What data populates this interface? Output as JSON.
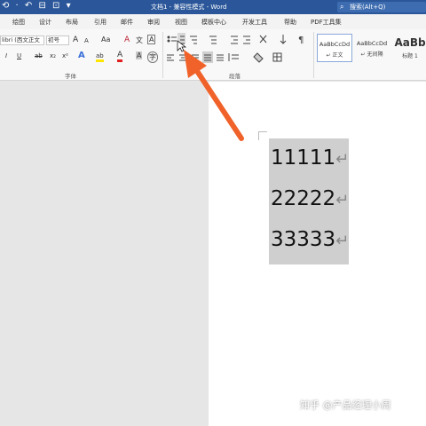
{
  "titlebar": {
    "quick_access": "⟲ · ↶ ⊟ ⊡ ▾",
    "title": "文档1 - 兼容性模式 - Word",
    "search_placeholder": "搜索(Alt+Q)"
  },
  "tabs": [
    "绘图",
    "设计",
    "布局",
    "引用",
    "邮件",
    "审阅",
    "视图",
    "模板中心",
    "开发工具",
    "帮助",
    "PDF工具集"
  ],
  "font": {
    "name": "libri (西文正文",
    "size": "初号",
    "grow": "A",
    "shrink": "A",
    "case": "Aa",
    "clear": "A",
    "phonetic": "文",
    "border_char": "A",
    "italic": "I",
    "underline": "U",
    "strike": "ab",
    "subscript": "x₂",
    "superscript": "x²",
    "effects": "A",
    "highlight": "ab",
    "font_color": "A",
    "shading": "A",
    "enclose": "字",
    "group_label": "字体"
  },
  "paragraph": {
    "group_label": "段落"
  },
  "styles": [
    {
      "sample": "AaBbCcDd",
      "name": "↵ 正文"
    },
    {
      "sample": "AaBbCcDd",
      "name": "↵ 无间隔"
    },
    {
      "sample": "AaBb",
      "name": "标题 1"
    }
  ],
  "document": {
    "lines": [
      "11111",
      "22222",
      "33333"
    ],
    "paragraph_mark": "↵"
  },
  "watermark": "知乎 @产品经理小周",
  "colors": {
    "accent_arrow": "#f0622a",
    "titlebar": "#2b579a",
    "selection": "#cfcfcf"
  }
}
